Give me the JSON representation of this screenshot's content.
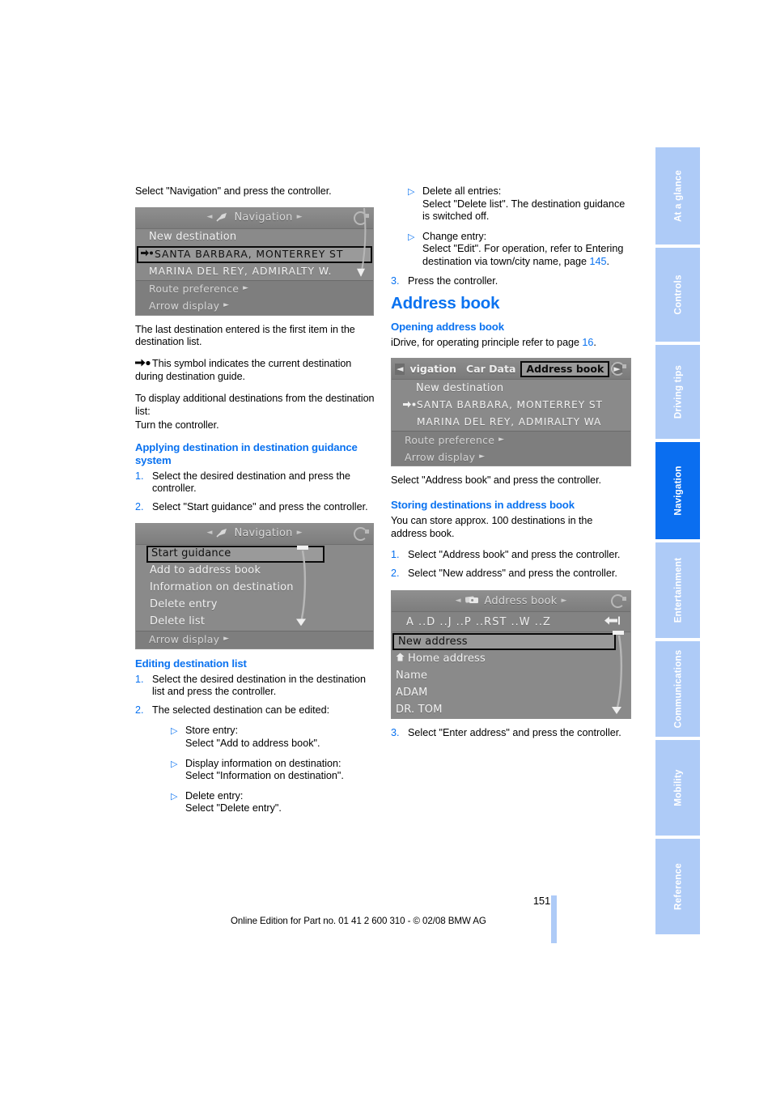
{
  "page": {
    "number": "151",
    "footer_note": "Online Edition for Part no. 01 41 2 600 310 - © 02/08 BMW AG"
  },
  "register_tabs": [
    {
      "label": "At a glance",
      "active": false
    },
    {
      "label": "Controls",
      "active": false
    },
    {
      "label": "Driving tips",
      "active": false
    },
    {
      "label": "Navigation",
      "active": true
    },
    {
      "label": "Entertainment",
      "active": false
    },
    {
      "label": "Communications",
      "active": false
    },
    {
      "label": "Mobility",
      "active": false
    },
    {
      "label": "Reference",
      "active": false
    }
  ],
  "colors": {
    "accent_blue": "#0a72f0",
    "tab_light_blue": "#aecbf7",
    "tab_active_blue": "#0a6ef0"
  },
  "left_column": {
    "intro_text": "Select \"Navigation\" and press the controller.",
    "figure_navigation": {
      "header_title": "Navigation",
      "header_left_arrow": "◄",
      "header_right_arrow": "►",
      "icon": "satellite-dish-icon",
      "rows": [
        {
          "text": "New destination",
          "selected": false,
          "symbol": ""
        },
        {
          "text": "SANTA BARBARA, MONTERREY ST",
          "selected": true,
          "symbol": "arrow-dot"
        },
        {
          "text": "MARINA DEL REY, ADMIRALTY W.",
          "selected": false,
          "symbol": ""
        }
      ],
      "footer_rows": [
        {
          "text": "Route preference",
          "chevron": "►"
        },
        {
          "text": "Arrow display",
          "chevron": "►"
        }
      ]
    },
    "para_last_destination": "The last destination entered is the first item in the destination list.",
    "para_symbol": "This symbol indicates the current destination during destination guide.",
    "para_additional": "To display additional destinations from the destination list:",
    "para_turn": "Turn the controller.",
    "heading_applying": "Applying destination in destination guidance system",
    "applying_steps": [
      {
        "num": "1.",
        "text": "Select the desired destination and press the controller."
      },
      {
        "num": "2.",
        "text": "Select \"Start guidance\" and press the controller."
      }
    ],
    "figure_start_guidance": {
      "header_title": "Navigation",
      "header_left_arrow": "◄",
      "header_right_arrow": "►",
      "icon": "satellite-dish-icon",
      "rows": [
        {
          "text": "Start guidance",
          "selected": true
        },
        {
          "text": "Add to address book",
          "selected": false
        },
        {
          "text": "Information on destination",
          "selected": false
        },
        {
          "text": "Delete entry",
          "selected": false
        },
        {
          "text": "Delete list",
          "selected": false
        }
      ],
      "footer_rows": [
        {
          "text": "Arrow display",
          "chevron": "►"
        }
      ]
    },
    "heading_editing": "Editing destination list",
    "editing_steps": [
      {
        "num": "1.",
        "text": "Select the desired destination in the destination list and press the controller."
      },
      {
        "num": "2.",
        "text": "The selected destination can be edited:"
      }
    ],
    "editing_bullets": [
      {
        "marker": "▷",
        "line1": "Store entry:",
        "line2": "Select \"Add to address book\"."
      },
      {
        "marker": "▷",
        "line1": "Display information on destination:",
        "line2": "Select \"Information on destination\"."
      },
      {
        "marker": "▷",
        "line1": "Delete entry:",
        "line2": "Select \"Delete entry\"."
      }
    ]
  },
  "right_column": {
    "continued_bullets": [
      {
        "marker": "▷",
        "line1": "Delete all entries:",
        "line2": "Select \"Delete list\". The destination guidance is switched off."
      },
      {
        "marker": "▷",
        "line1": "Change entry:",
        "line2": "Select \"Edit\". For operation, refer to Entering destination via town/city name, page ",
        "pageref": "145",
        "line2_tail": "."
      }
    ],
    "step_three": {
      "num": "3.",
      "text": "Press the controller."
    },
    "chapter_title": "Address book",
    "heading_opening": "Opening address book",
    "para_idrive_pre": "iDrive, for operating principle refer to page ",
    "para_idrive_ref": "16",
    "para_idrive_post": ".",
    "figure_address_book_tabs": {
      "left_arrow": "◄",
      "right_arrow": "►",
      "tabs": [
        {
          "label": "vigation",
          "active": false
        },
        {
          "label": "Car Data",
          "active": false
        },
        {
          "label": "Address book",
          "active": true
        }
      ],
      "rows": [
        {
          "text": "New destination",
          "symbol": ""
        },
        {
          "text": "SANTA BARBARA, MONTERREY ST",
          "symbol": "arrow-dot"
        },
        {
          "text": "MARINA DEL REY, ADMIRALTY WA",
          "symbol": ""
        }
      ],
      "footer_rows": [
        {
          "text": "Route preference",
          "chevron": "►"
        },
        {
          "text": "Arrow display",
          "chevron": "►"
        }
      ]
    },
    "para_select_address_book": "Select \"Address book\" and press the controller.",
    "heading_storing": "Storing destinations in address book",
    "para_store_capacity": "You can store approx. 100 destinations in the address book.",
    "storing_steps": [
      {
        "num": "1.",
        "text": "Select \"Address book\" and press the controller."
      },
      {
        "num": "2.",
        "text": "Select \"New address\" and press the controller."
      }
    ],
    "figure_address_book": {
      "header_title": "Address book",
      "header_left_arrow": "◄",
      "header_right_arrow": "►",
      "icon": "address-cards-icon",
      "alpha_bar": "A ..D ..J ..P ..RST ..W ..Z",
      "alpha_back_icon": "back-arrow-icon",
      "rows": [
        {
          "text": "New address",
          "selected": true,
          "symbol": ""
        },
        {
          "text": "Home address",
          "selected": false,
          "symbol": "home-icon"
        },
        {
          "text": "Name",
          "selected": false,
          "symbol": ""
        },
        {
          "text": "ADAM",
          "selected": false,
          "symbol": ""
        },
        {
          "text": "DR. TOM",
          "selected": false,
          "symbol": ""
        }
      ]
    },
    "step_three_address": {
      "num": "3.",
      "text": "Select \"Enter address\" and press the controller."
    }
  }
}
